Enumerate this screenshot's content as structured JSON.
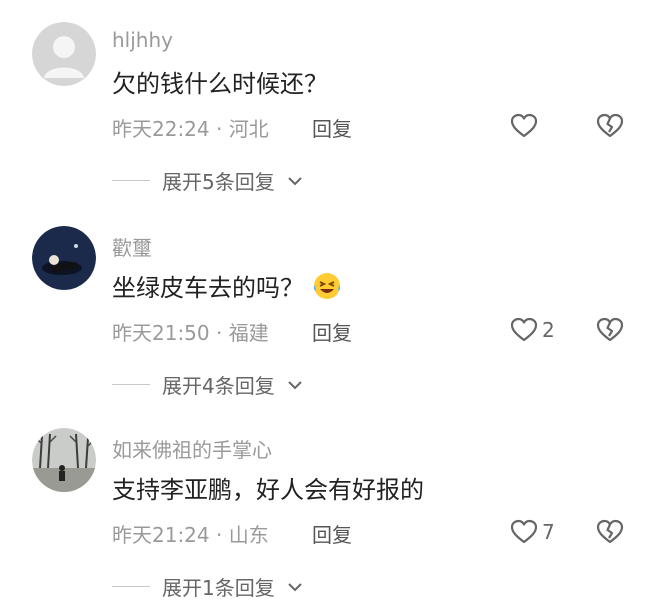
{
  "comments": [
    {
      "username": "hljhhy",
      "text": "欠的钱什么时候还？",
      "emoji": "",
      "time": "昨天22:24",
      "sep": "·",
      "location": "河北",
      "reply_label": "回复",
      "like_count": "",
      "expand_label": "展开5条回复"
    },
    {
      "username": "歡璽",
      "text": "坐绿皮车去的吗？",
      "emoji": "laughing-crying-emoji",
      "time": "昨天21:50",
      "sep": "·",
      "location": "福建",
      "reply_label": "回复",
      "like_count": "2",
      "expand_label": "展开4条回复"
    },
    {
      "username": "如来佛祖的手掌心",
      "text": "支持李亚鹏，好人会有好报的",
      "emoji": "",
      "time": "昨天21:24",
      "sep": "·",
      "location": "山东",
      "reply_label": "回复",
      "like_count": "7",
      "expand_label": "展开1条回复"
    }
  ],
  "colors": {
    "meta": "#9a9a9a",
    "text": "#222222",
    "icon": "#666666"
  }
}
